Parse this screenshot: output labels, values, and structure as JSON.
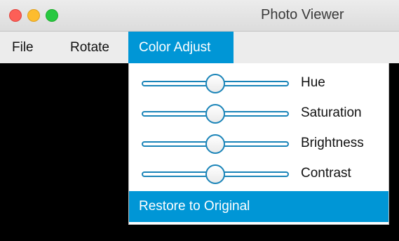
{
  "window": {
    "title": "Photo Viewer",
    "controls": {
      "close_color": "#fd5f57",
      "minimize_color": "#fdbc2e",
      "zoom_color": "#27c840"
    }
  },
  "menubar": {
    "items": [
      {
        "label": "File",
        "active": false
      },
      {
        "label": "Rotate",
        "active": false
      },
      {
        "label": "Color Adjust",
        "active": true
      }
    ]
  },
  "color_adjust_menu": {
    "sliders": [
      {
        "label": "Hue",
        "value_fraction": 0.5
      },
      {
        "label": "Saturation",
        "value_fraction": 0.5
      },
      {
        "label": "Brightness",
        "value_fraction": 0.5
      },
      {
        "label": "Contrast",
        "value_fraction": 0.5
      }
    ],
    "restore_label": "Restore to Original"
  },
  "colors": {
    "accent": "#0096d6",
    "slider_stroke": "#1a84b8",
    "canvas_background": "#000000"
  }
}
